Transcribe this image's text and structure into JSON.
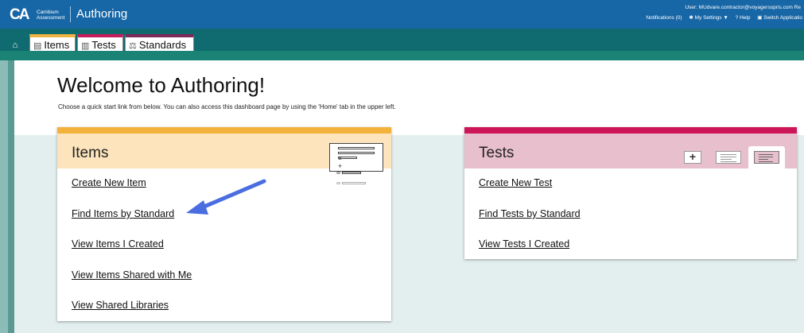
{
  "header": {
    "logo_mark": "CA",
    "logo_line1": "Cambium",
    "logo_line2": "Assessment",
    "app_title": "Authoring",
    "user_line": "User: MUdvare.contractor@voyagersopris.com  Re",
    "notifications": "Notifications (0)",
    "my_settings": "My Settings",
    "help": "Help",
    "switch_app": "Switch Applicatio"
  },
  "tabs": [
    {
      "label": "Items",
      "icon": "document-icon",
      "accent": "#f1b340"
    },
    {
      "label": "Tests",
      "icon": "stack-icon",
      "accent": "#c51a5b"
    },
    {
      "label": "Standards",
      "icon": "balance-scale-icon",
      "accent": "#7d2a5a"
    }
  ],
  "page": {
    "title": "Welcome to Authoring!",
    "subtitle": "Choose a quick start link from below. You can also access this dashboard page by using the 'Home' tab in the upper left."
  },
  "items_card": {
    "title": "Items",
    "links": [
      "Create New Item",
      "Find Items by Standard",
      "View Items I Created",
      "View Items Shared with Me",
      "View Shared Libraries"
    ]
  },
  "tests_card": {
    "title": "Tests",
    "links": [
      "Create New Test",
      "Find Tests by Standard",
      "View Tests I Created"
    ]
  },
  "colors": {
    "header_bg": "#1766a6",
    "tabbar_bg": "#0f6b6f",
    "items_accent": "#f3b23c",
    "tests_accent": "#cc1659",
    "arrow": "#4a6de0"
  }
}
